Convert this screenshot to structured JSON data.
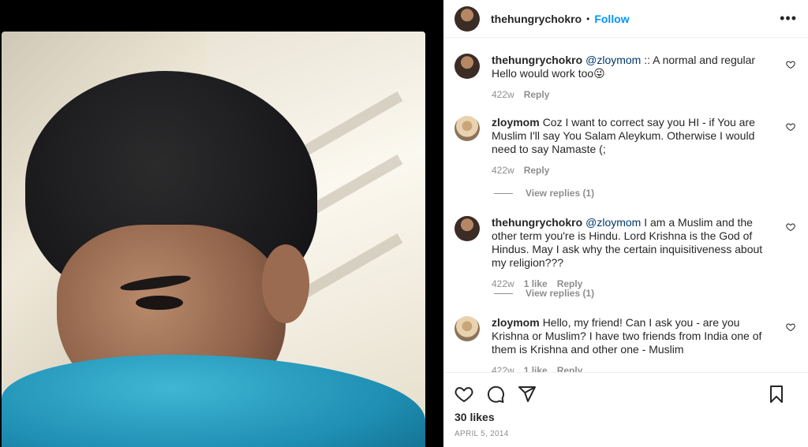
{
  "post": {
    "author": "thehungrychokro",
    "follow_label": "Follow",
    "separator": "•",
    "more_label": "•••"
  },
  "comments": [
    {
      "username": "thehungrychokro",
      "mention": "@zloymom",
      "text": " :: A normal and regular Hello would work too😜",
      "time": "422w",
      "likes": "",
      "reply_label": "Reply"
    },
    {
      "username": "zloymom",
      "mention": "",
      "text": "Coz I want to correct say you HI - if You are Muslim I'll say You Salam Aleykum. Otherwise I would need to say Namaste (;",
      "time": "422w",
      "likes": "",
      "reply_label": "Reply",
      "view_replies": "View replies (1)"
    },
    {
      "username": "thehungrychokro",
      "mention": "@zloymom",
      "text": " I am a Muslim and the other term you're is Hindu. Lord Krishna is the God of Hindus. May I ask why the certain inquisitiveness about my religion???",
      "time": "422w",
      "likes": "1 like",
      "reply_label": "Reply",
      "view_replies": "View replies (1)"
    },
    {
      "username": "zloymom",
      "mention": "",
      "text": "Hello, my friend! Can I ask you - are you Krishna or Muslim? I have two friends from India one of them is Krishna and other one - Muslim",
      "time": "422w",
      "likes": "1 like",
      "reply_label": "Reply"
    }
  ],
  "footer": {
    "likes": "30 likes",
    "date": "APRIL 5, 2014"
  },
  "icons": {
    "like": "heart-icon",
    "comment": "comment-icon",
    "share": "share-icon",
    "save": "bookmark-icon",
    "more": "more-options-icon"
  }
}
